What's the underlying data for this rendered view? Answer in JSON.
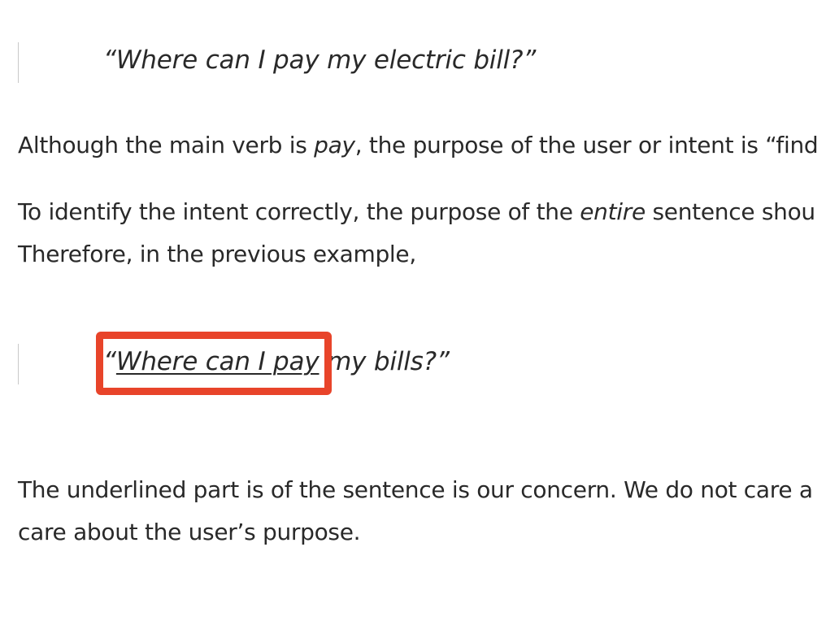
{
  "quote1": {
    "text": "“Where can I pay my electric bill?”"
  },
  "para1": {
    "before": "Although the main verb is ",
    "emphasis": "pay",
    "after": ", the purpose of the user or intent is “find"
  },
  "para2": {
    "line1_before": "To identify the intent correctly, the purpose of the ",
    "line1_emphasis": "entire",
    "line1_after": " sentence shou",
    "line2": "Therefore, in the previous example,"
  },
  "quote2": {
    "open_quote": "“",
    "underlined": "Where can I pay",
    "rest": " my bills?”"
  },
  "para3": {
    "line1": "The underlined part is of the sentence is our concern. We do not care a",
    "line2": "care about the user’s purpose."
  },
  "colors": {
    "text": "#292929",
    "highlight": "#e8442a",
    "quote_bar": "#c8c8c8"
  }
}
